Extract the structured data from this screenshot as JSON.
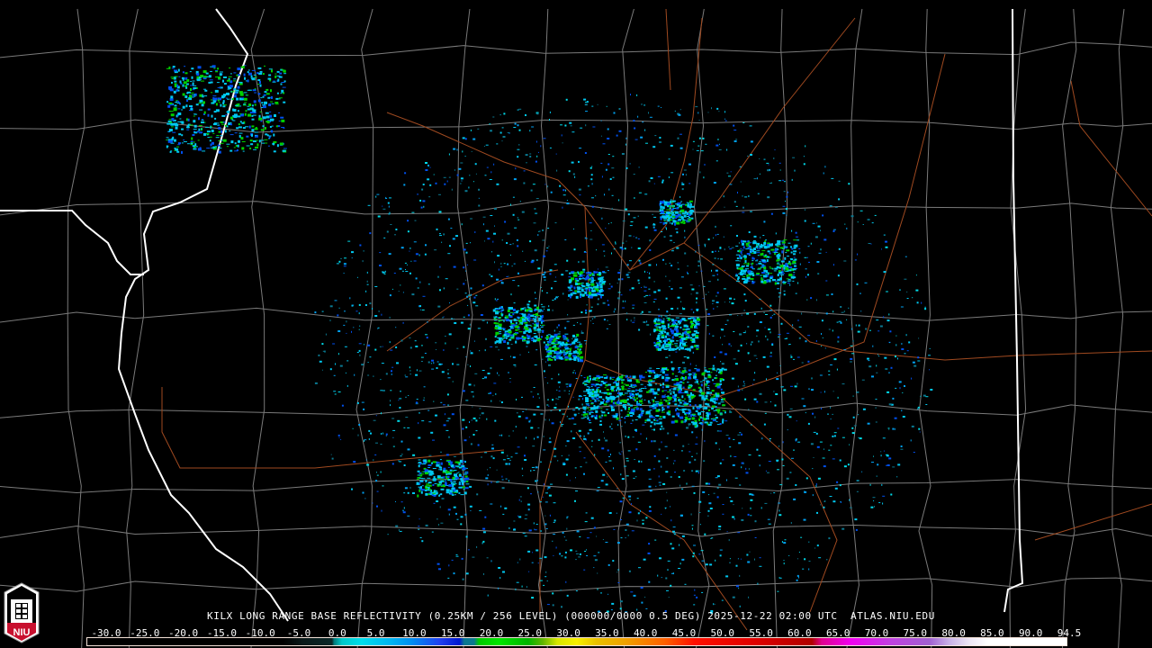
{
  "product": {
    "title": "KILX LONG RANGE BASE REFLECTIVITY (0.25KM / 256 LEVEL) (000000/0000 0.5 DEG) 2025-12-22 02:00 UTC  ATLAS.NIU.EDU",
    "radar_site": "KILX",
    "timestamp": "2025-12-22 02:00 UTC",
    "source": "ATLAS.NIU.EDU"
  },
  "logo": {
    "text": "NIU",
    "icon": "niu-castle-logo"
  },
  "colorbar": {
    "labels": [
      "-30.0",
      "-25.0",
      "-20.0",
      "-15.0",
      "-10.0",
      "-5.0",
      "0.0",
      "5.0",
      "10.0",
      "15.0",
      "20.0",
      "25.0",
      "30.0",
      "35.0",
      "40.0",
      "45.0",
      "50.0",
      "55.0",
      "60.0",
      "65.0",
      "70.0",
      "75.0",
      "80.0",
      "85.0",
      "90.0",
      "94.5"
    ],
    "min": -30,
    "max": 94.5
  },
  "colors": {
    "state_border": "#ffffff",
    "county_border": "#808080",
    "highway": "#a04a20",
    "echo_low": "#00c8f0",
    "echo_mid": "#0050f0",
    "echo_high": "#00d000"
  }
}
